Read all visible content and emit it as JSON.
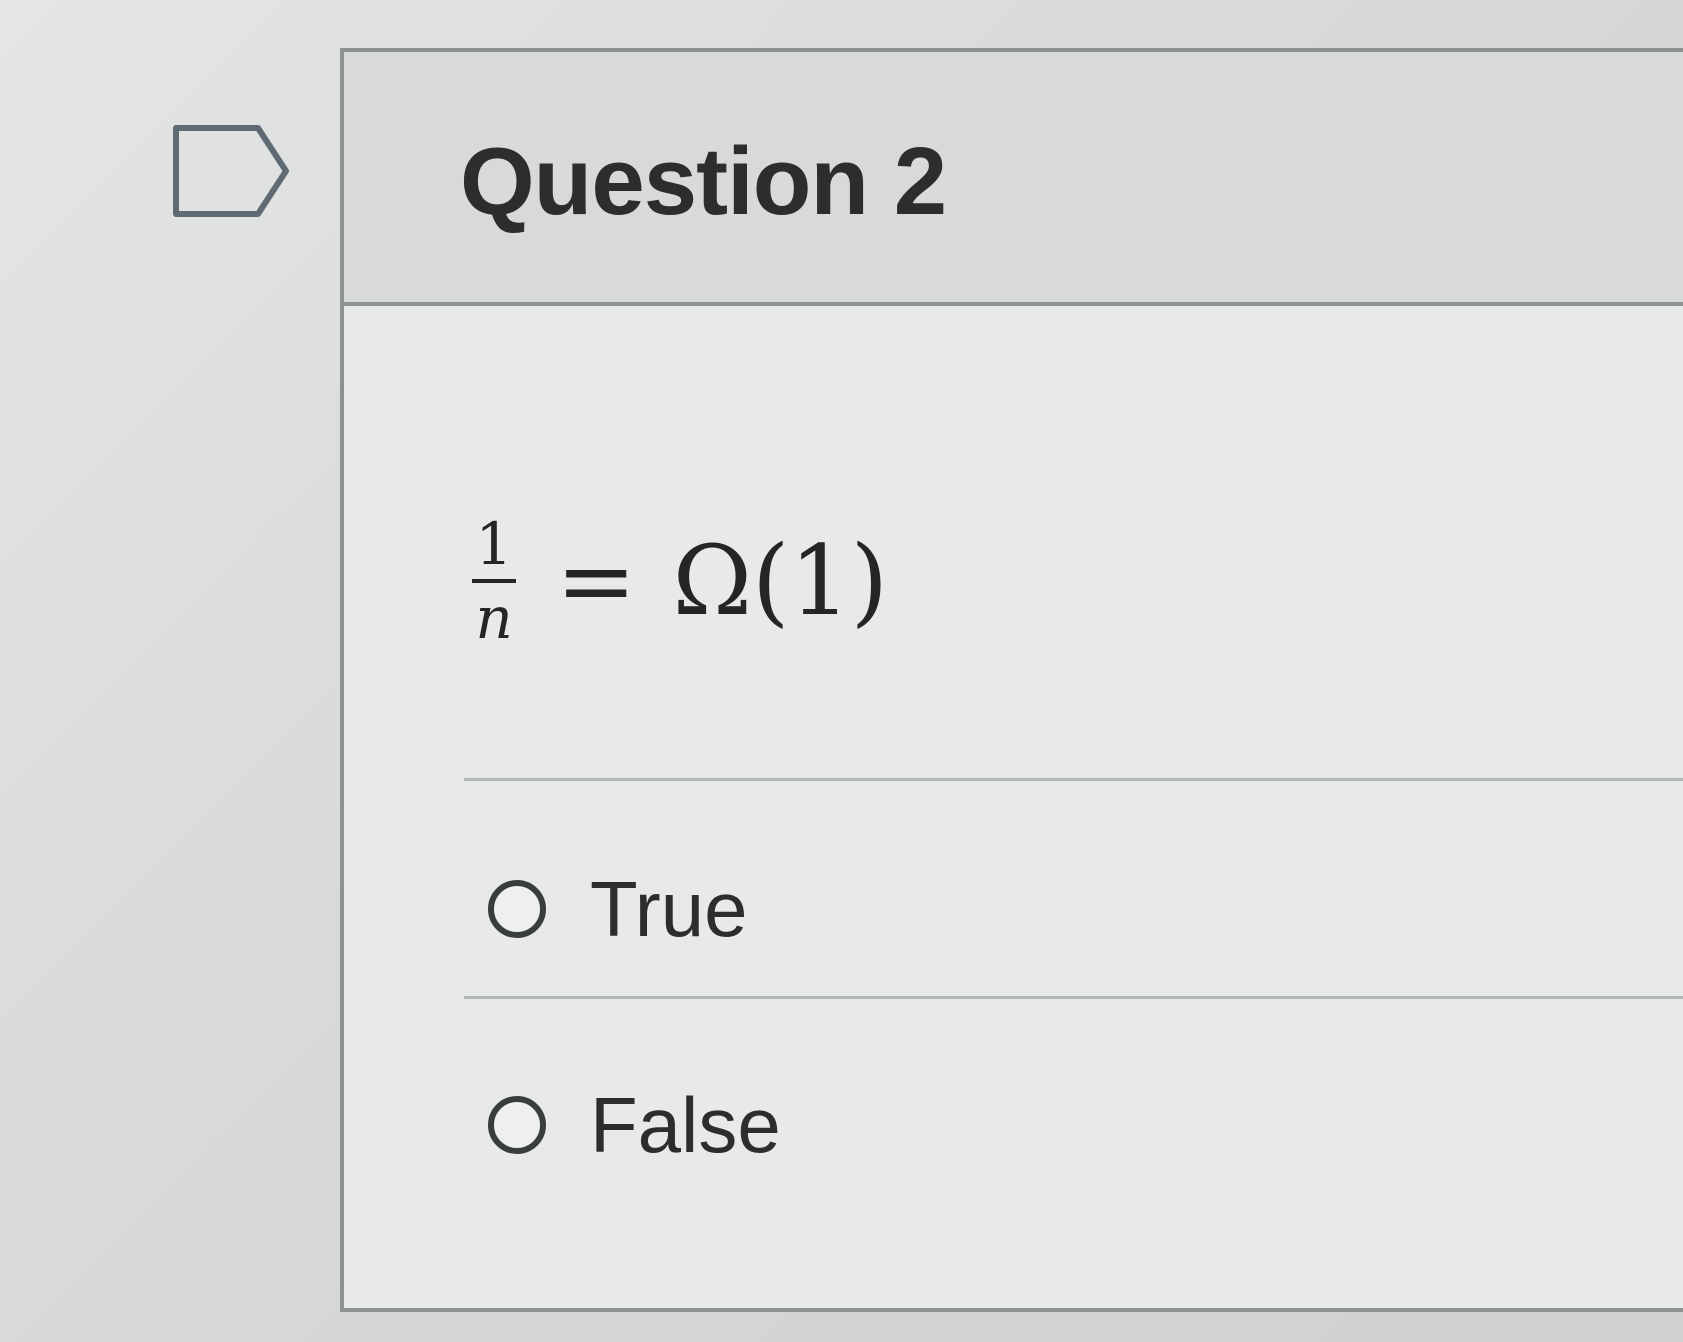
{
  "question": {
    "title": "Question 2",
    "flag_icon": "flag-outline-icon",
    "equation": {
      "numerator": "1",
      "denominator": "n",
      "operator": "=",
      "rhs": "Ω(1)"
    },
    "answers": [
      {
        "label": "True",
        "selected": false
      },
      {
        "label": "False",
        "selected": false
      }
    ]
  }
}
